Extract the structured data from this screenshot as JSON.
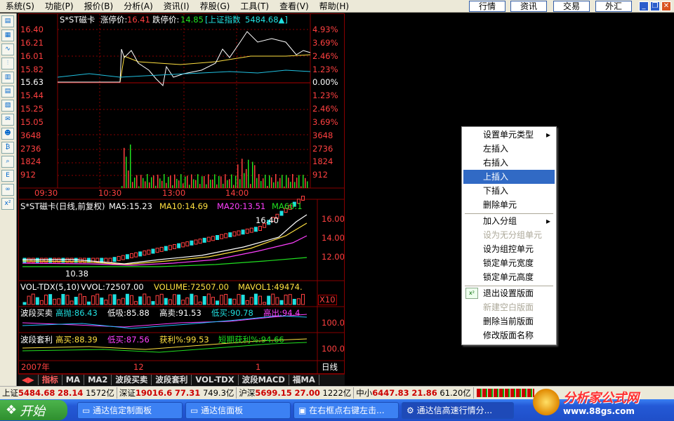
{
  "menubar": {
    "items": [
      "系统(S)",
      "功能(P)",
      "报价(B)",
      "分析(A)",
      "资讯(I)",
      "荐股(G)",
      "工具(T)",
      "查看(V)",
      "帮助(H)"
    ],
    "buttons": [
      "行情",
      "资讯",
      "交易",
      "外汇"
    ]
  },
  "chart": {
    "stock": "S*ST磁卡",
    "limit_up_label": "涨停价:",
    "limit_up": "16.41",
    "limit_down_label": "跌停价:",
    "limit_down": "14.85",
    "index_label": "[上证指数",
    "index_value": "5484.68▲]",
    "price_ticks": [
      "16.40",
      "16.21",
      "16.01",
      "15.82",
      "15.63",
      "15.44",
      "15.25",
      "15.05"
    ],
    "pct_ticks": [
      "4.93%",
      "3.69%",
      "2.46%",
      "1.23%",
      "0.00%",
      "1.23%",
      "2.46%",
      "3.69%"
    ],
    "vol_ticks": [
      "3648",
      "2736",
      "1824",
      "912"
    ],
    "time_ticks": [
      "09:30",
      "10:30",
      "13:00",
      "14:00"
    ],
    "daily_title": "S*ST磁卡(日线,前复权)",
    "ma5": "MA5:15.23",
    "ma10": "MA10:14.69",
    "ma20": "MA20:13.51",
    "ma60": "MA60:1",
    "high_mark": "16.40",
    "low_mark": "10.38",
    "daily_ticks": [
      "16.00",
      "14.00",
      "12.00"
    ],
    "vol_title": "VOL-TDX(5,10)",
    "vvol": "VVOL:72507.00",
    "volume": "VOLUME:72507.00",
    "mavol": "MAVOL1:49474.",
    "vol_unit": "X10",
    "bd_title": "波段买卖",
    "bd_gp": "高抛:86.43",
    "bd_dx": "低吸:85.88",
    "bd_gm": "高卖:91.53",
    "bd_dm": "低买:90.78",
    "bd_gc": "高出:94.4",
    "bd_tick": "100.0",
    "bt_title": "波段套利",
    "bt_gm": "高买:88.39",
    "bt_dm": "低买:87.56",
    "bt_hl": "获利%:99.53",
    "bt_dq": "短期获利%:94.66",
    "bt_tick": "100.0",
    "year": "2007年",
    "month": "12",
    "mon1": "1",
    "period": "日线"
  },
  "tabs": [
    "指标",
    "MA",
    "MA2",
    "波段买卖",
    "波段套利",
    "VOL-TDX",
    "波段MACD",
    "福MA"
  ],
  "context_menu": [
    {
      "label": "设置单元类型",
      "arrow": "▸",
      "disabled": false
    },
    {
      "label": "左插入",
      "disabled": false
    },
    {
      "label": "右插入",
      "disabled": false
    },
    {
      "label": "上插入",
      "disabled": false,
      "selected": true
    },
    {
      "label": "下插入",
      "disabled": false
    },
    {
      "label": "删除单元",
      "disabled": false
    },
    {
      "label": "加入分组",
      "arrow": "▸",
      "disabled": false
    },
    {
      "label": "设为无分组单元",
      "disabled": true
    },
    {
      "label": "设为组控单元",
      "disabled": false
    },
    {
      "label": "锁定单元宽度",
      "disabled": false
    },
    {
      "label": "锁定单元高度",
      "disabled": false
    },
    {
      "label": "退出设置版面",
      "disabled": false
    },
    {
      "label": "新建空白版面",
      "disabled": true
    },
    {
      "label": "删除当前版面",
      "disabled": false
    },
    {
      "label": "修改版面名称",
      "disabled": false
    }
  ],
  "statusbar": {
    "sh_label": "上证",
    "sh": "5484.68",
    "sh_chg": "28.14",
    "sh_amt": "1572亿",
    "sz_label": "深证",
    "sz": "19016.6",
    "sz_chg": "77.31",
    "sz_amt": "749.3亿",
    "hs_label": "沪深",
    "hs": "5699.15",
    "hs_chg": "27.00",
    "hs_amt": "1222亿",
    "zx_label": "中小",
    "zx": "6447.83",
    "zx_chg": "21.86",
    "zx_amt": "61.20亿"
  },
  "taskbar": {
    "start": "开始",
    "tasks": [
      "通达信定制面板",
      "通达信面板",
      "在右框点右键左击...",
      "通达信高速行情分..."
    ]
  },
  "logo": {
    "text": "分析家公式网",
    "url": "www.88gs.com"
  }
}
